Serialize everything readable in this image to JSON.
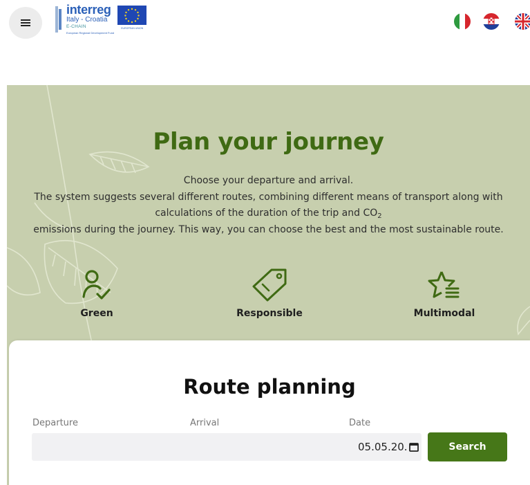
{
  "header": {
    "logo": {
      "brand_name": "interreg",
      "region": "Italy - Croatia",
      "project": "E-CHAIN",
      "fund_caption": "European Regional Development Fund",
      "eu_caption": "EUROPEAN UNION"
    },
    "languages": [
      "it",
      "hr",
      "en"
    ]
  },
  "hero": {
    "title": "Plan your journey",
    "line1": "Choose your departure and arrival.",
    "line2": "The system suggests several different routes, combining different means of transport along with",
    "line3_prefix": "calculations of the duration of the trip and CO",
    "line3_sub": "2",
    "line4": "emissions during the journey. This way, you can choose the best and the most sustainable route.",
    "features": [
      {
        "label": "Green",
        "icon": "person-check-icon"
      },
      {
        "label": "Responsible",
        "icon": "tag-icon"
      },
      {
        "label": "Multimodal",
        "icon": "star-list-icon"
      }
    ]
  },
  "route": {
    "title": "Route planning",
    "departure_label": "Departure",
    "arrival_label": "Arrival",
    "date_label": "Date",
    "departure_value": "",
    "arrival_value": "",
    "date_value": "05.05.20.",
    "search_label": "Search"
  },
  "colors": {
    "hero_bg": "#c7cfae",
    "title_green": "#3f6a13",
    "button_green": "#467718",
    "brand_blue": "#2b60b8"
  }
}
